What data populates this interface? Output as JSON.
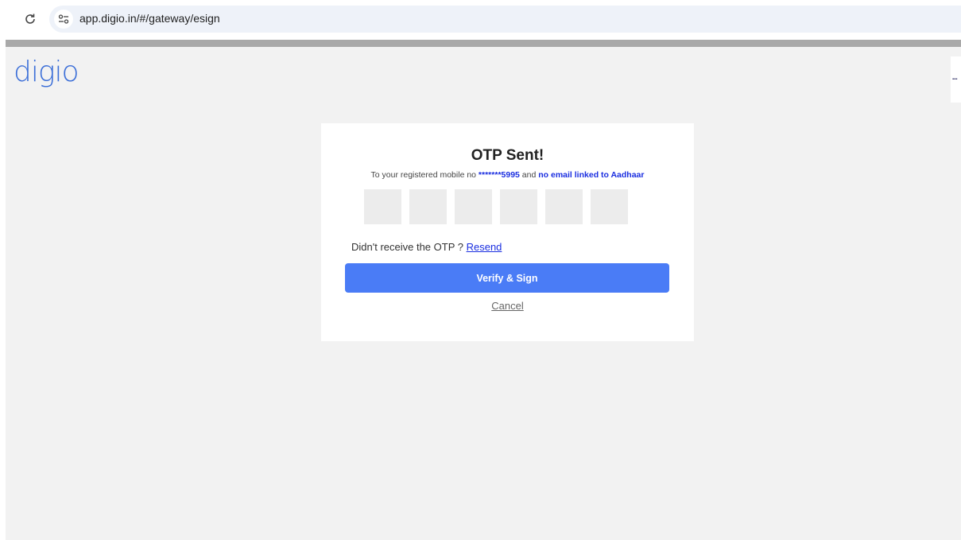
{
  "browser": {
    "url": "app.digio.in/#/gateway/esign"
  },
  "page": {
    "logo_text": "digio",
    "side_mark": "▪▪▪"
  },
  "otp_card": {
    "title": "OTP Sent!",
    "subtitle_prefix": "To your registered mobile no ",
    "masked_mobile": "*******5995",
    "subtitle_middle": " and ",
    "email_status": "no email linked to Aadhaar",
    "otp_digits": [
      "",
      "",
      "",
      "",
      "",
      ""
    ],
    "resend_prompt": "Didn't receive the OTP ? ",
    "resend_label": "Resend",
    "verify_label": "Verify & Sign",
    "cancel_label": "Cancel"
  },
  "icons": {
    "reload": "reload-icon",
    "site_info": "tune-icon"
  },
  "colors": {
    "accent": "#4a7cf6",
    "link": "#1a2ee0",
    "logo": "#3c6fd8",
    "page_bg": "#f2f2f2"
  }
}
